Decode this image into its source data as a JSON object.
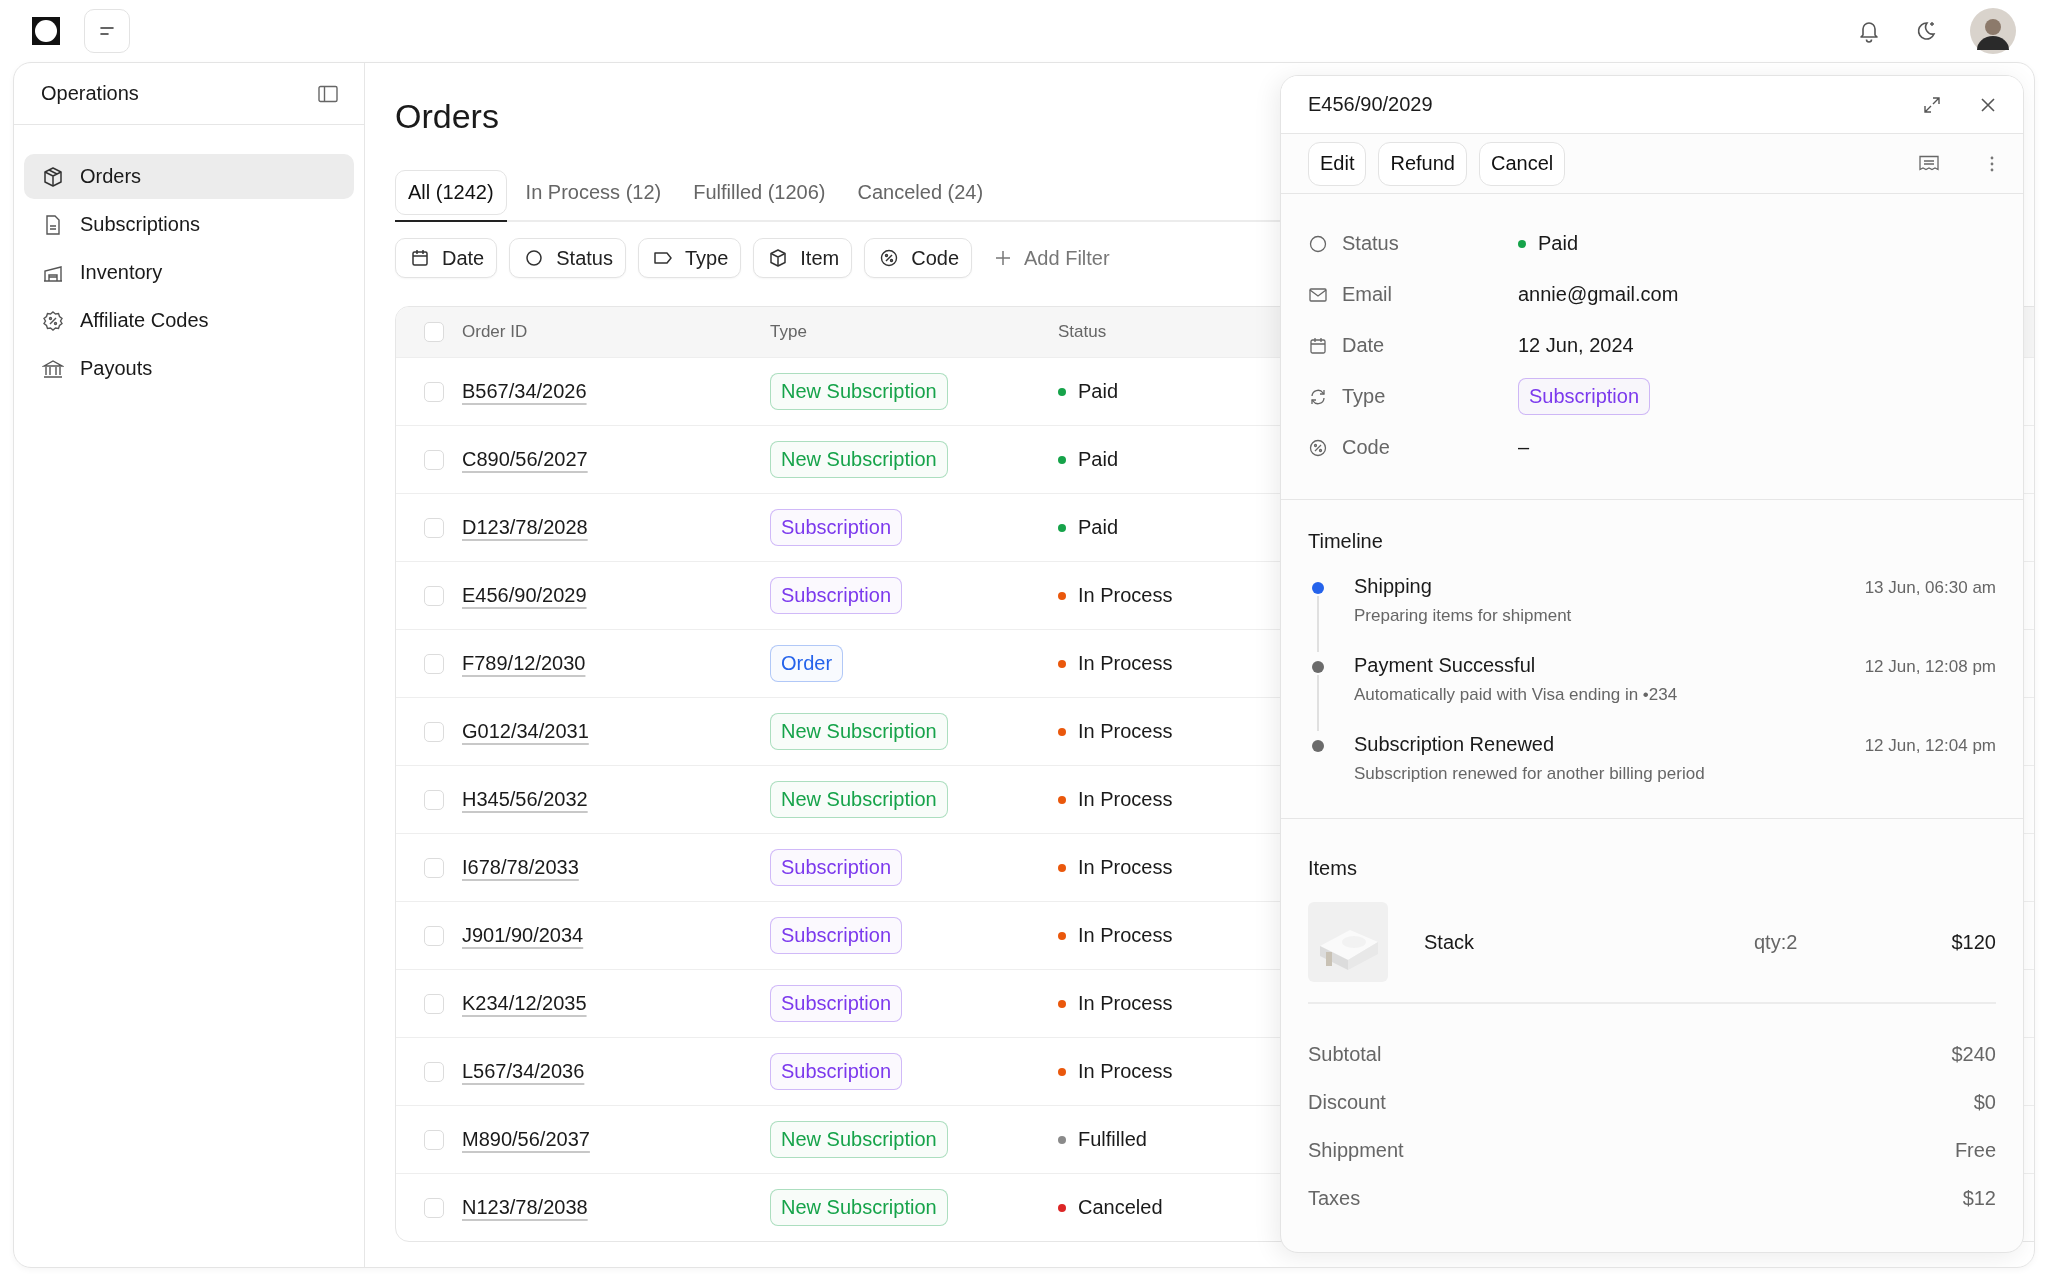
{
  "sidebar": {
    "title": "Operations",
    "items": [
      {
        "label": "Orders",
        "selected": true
      },
      {
        "label": "Subscriptions",
        "selected": false
      },
      {
        "label": "Inventory",
        "selected": false
      },
      {
        "label": "Affiliate Codes",
        "selected": false
      },
      {
        "label": "Payouts",
        "selected": false
      }
    ]
  },
  "page": {
    "title": "Orders",
    "tabs": [
      {
        "label": "All (1242)",
        "selected": true
      },
      {
        "label": "In Process (12)",
        "selected": false
      },
      {
        "label": "Fulfilled (1206)",
        "selected": false
      },
      {
        "label": "Canceled (24)",
        "selected": false
      }
    ],
    "filters": [
      {
        "label": "Date"
      },
      {
        "label": "Status"
      },
      {
        "label": "Type"
      },
      {
        "label": "Item"
      },
      {
        "label": "Code"
      }
    ],
    "add_filter": "Add Filter"
  },
  "table": {
    "columns": [
      "Order ID",
      "Type",
      "Status"
    ],
    "all_checked": false,
    "rows": [
      {
        "id": "B567/34/2026",
        "checked": false,
        "type": {
          "label": "New Subscription",
          "color": "#16a34a"
        },
        "status": {
          "label": "Paid",
          "color": "#16a34a"
        }
      },
      {
        "id": "C890/56/2027",
        "checked": false,
        "type": {
          "label": "New Subscription",
          "color": "#16a34a"
        },
        "status": {
          "label": "Paid",
          "color": "#16a34a"
        }
      },
      {
        "id": "D123/78/2028",
        "checked": false,
        "type": {
          "label": "Subscription",
          "color": "#7c3aed"
        },
        "status": {
          "label": "Paid",
          "color": "#16a34a"
        }
      },
      {
        "id": "E456/90/2029",
        "checked": false,
        "type": {
          "label": "Subscription",
          "color": "#7c3aed"
        },
        "status": {
          "label": "In Process",
          "color": "#ea580c"
        }
      },
      {
        "id": "F789/12/2030",
        "checked": false,
        "type": {
          "label": "Order",
          "color": "#2563eb"
        },
        "status": {
          "label": "In Process",
          "color": "#ea580c"
        }
      },
      {
        "id": "G012/34/2031",
        "checked": false,
        "type": {
          "label": "New Subscription",
          "color": "#16a34a"
        },
        "status": {
          "label": "In Process",
          "color": "#ea580c"
        }
      },
      {
        "id": "H345/56/2032",
        "checked": false,
        "type": {
          "label": "New Subscription",
          "color": "#16a34a"
        },
        "status": {
          "label": "In Process",
          "color": "#ea580c"
        }
      },
      {
        "id": "I678/78/2033",
        "checked": false,
        "type": {
          "label": "Subscription",
          "color": "#7c3aed"
        },
        "status": {
          "label": "In Process",
          "color": "#ea580c"
        }
      },
      {
        "id": "J901/90/2034",
        "checked": false,
        "type": {
          "label": "Subscription",
          "color": "#7c3aed"
        },
        "status": {
          "label": "In Process",
          "color": "#ea580c"
        }
      },
      {
        "id": "K234/12/2035",
        "checked": false,
        "type": {
          "label": "Subscription",
          "color": "#7c3aed"
        },
        "status": {
          "label": "In Process",
          "color": "#ea580c"
        }
      },
      {
        "id": "L567/34/2036",
        "checked": false,
        "type": {
          "label": "Subscription",
          "color": "#7c3aed"
        },
        "status": {
          "label": "In Process",
          "color": "#ea580c"
        }
      },
      {
        "id": "M890/56/2037",
        "checked": false,
        "type": {
          "label": "New Subscription",
          "color": "#16a34a"
        },
        "status": {
          "label": "Fulfilled",
          "color": "#8a8a8a"
        }
      },
      {
        "id": "N123/78/2038",
        "checked": false,
        "type": {
          "label": "New Subscription",
          "color": "#16a34a"
        },
        "status": {
          "label": "Canceled",
          "color": "#dc2626"
        }
      }
    ]
  },
  "detail": {
    "title": "E456/90/2029",
    "actions": [
      "Edit",
      "Refund",
      "Cancel"
    ],
    "properties": [
      {
        "label": "Status",
        "kind": "status",
        "value": "Paid",
        "color": "#16a34a"
      },
      {
        "label": "Email",
        "kind": "text",
        "value": "annie@gmail.com"
      },
      {
        "label": "Date",
        "kind": "text",
        "value": "12 Jun, 2024"
      },
      {
        "label": "Type",
        "kind": "badge",
        "value": "Subscription",
        "color": "#7c3aed"
      },
      {
        "label": "Code",
        "kind": "text",
        "value": "–"
      }
    ],
    "timeline_title": "Timeline",
    "timeline": [
      {
        "title": "Shipping",
        "description": "Preparing items for shipment",
        "time": "13 Jun, 06:30 am",
        "color": "#2563eb"
      },
      {
        "title": "Payment Successful",
        "description": "Automatically paid with Visa ending in •234",
        "time": "12 Jun, 12:08 pm",
        "color": "#6b6b6b"
      },
      {
        "title": "Subscription Renewed",
        "description": "Subscription renewed for another billing period",
        "time": "12 Jun, 12:04 pm",
        "color": "#6b6b6b"
      }
    ],
    "items_title": "Items",
    "items": [
      {
        "kind": "picture",
        "name": "Stack",
        "qty": "qty:2",
        "price": "$120"
      }
    ],
    "summary": [
      {
        "label": "Subtotal",
        "value": "$240"
      },
      {
        "label": "Discount",
        "value": "$0"
      },
      {
        "label": "Shippment",
        "value": "Free"
      },
      {
        "label": "Taxes",
        "value": "$12"
      }
    ]
  }
}
